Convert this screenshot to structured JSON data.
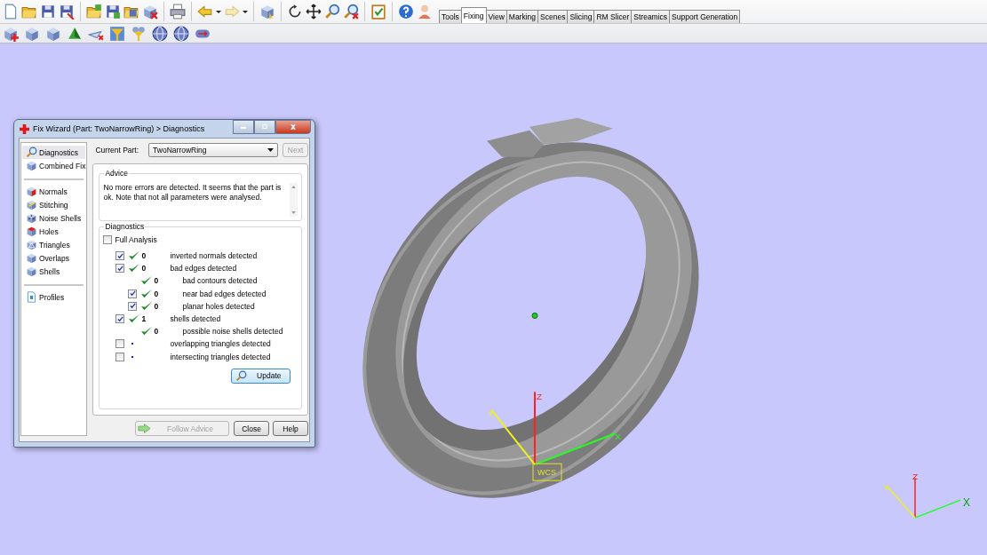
{
  "tabs": [
    {
      "label": "Tools",
      "selected": false
    },
    {
      "label": "Fixing",
      "selected": true
    },
    {
      "label": "View",
      "selected": false
    },
    {
      "label": "Marking",
      "selected": false
    },
    {
      "label": "Scenes",
      "selected": false
    },
    {
      "label": "Slicing",
      "selected": false
    },
    {
      "label": "RM Slicer",
      "selected": false
    },
    {
      "label": "Streamics",
      "selected": false
    },
    {
      "label": "Support Generation",
      "selected": false
    }
  ],
  "viewport": {
    "wcs_label": "WCS",
    "axes": {
      "x": "X",
      "y": "Y",
      "z": "Z"
    },
    "mini_axes": {
      "x": "X",
      "y": "Y",
      "z": "Z"
    }
  },
  "dialog": {
    "title": "Fix Wizard (Part: TwoNarrowRing) > Diagnostics",
    "nav_groups": [
      [
        {
          "label": "Diagnostics",
          "selected": true
        },
        {
          "label": "Combined Fix",
          "selected": false
        }
      ],
      [
        {
          "label": "Normals",
          "selected": false
        },
        {
          "label": "Stitching",
          "selected": false
        },
        {
          "label": "Noise Shells",
          "selected": false
        },
        {
          "label": "Holes",
          "selected": false
        },
        {
          "label": "Triangles",
          "selected": false
        },
        {
          "label": "Overlaps",
          "selected": false
        },
        {
          "label": "Shells",
          "selected": false
        }
      ],
      [
        {
          "label": "Profiles",
          "selected": false
        }
      ]
    ],
    "current_part_label": "Current Part:",
    "current_part": "TwoNarrowRing",
    "next_button": {
      "label": "Next",
      "disabled": true
    },
    "advice": {
      "title": "Advice",
      "text": "No more errors are detected. It seems that the part is ok. Note that not all parameters were analysed."
    },
    "diagnostics": {
      "title": "Diagnostics",
      "full_analysis": {
        "label": "Full Analysis",
        "checked": false
      },
      "rows": [
        {
          "kind": "toggle",
          "checked": true,
          "passed": true,
          "count": "0",
          "label": "inverted normals detected"
        },
        {
          "kind": "toggle",
          "checked": true,
          "passed": true,
          "count": "0",
          "label": "bad edges detected",
          "children": [
            {
              "kind": "fixed",
              "passed": true,
              "count": "0",
              "label": "bad contours detected"
            },
            {
              "kind": "toggle",
              "checked": true,
              "passed": true,
              "count": "0",
              "label": "near bad edges detected"
            },
            {
              "kind": "toggle",
              "checked": true,
              "passed": true,
              "count": "0",
              "label": "planar holes detected"
            }
          ]
        },
        {
          "kind": "toggle",
          "checked": true,
          "passed": true,
          "count": "1",
          "label": "shells detected",
          "children": [
            {
              "kind": "fixed",
              "passed": true,
              "count": "0",
              "label": "possible noise shells detected"
            }
          ]
        },
        {
          "kind": "toggle",
          "checked": false,
          "passed": false,
          "label": "overlapping triangles detected"
        },
        {
          "kind": "toggle",
          "checked": false,
          "passed": false,
          "label": "intersecting triangles detected"
        }
      ],
      "update_button": "Update"
    },
    "buttons": [
      {
        "label": "Follow Advice",
        "disabled": true
      },
      {
        "label": "Close",
        "disabled": false
      },
      {
        "label": "Help",
        "disabled": false
      }
    ]
  }
}
